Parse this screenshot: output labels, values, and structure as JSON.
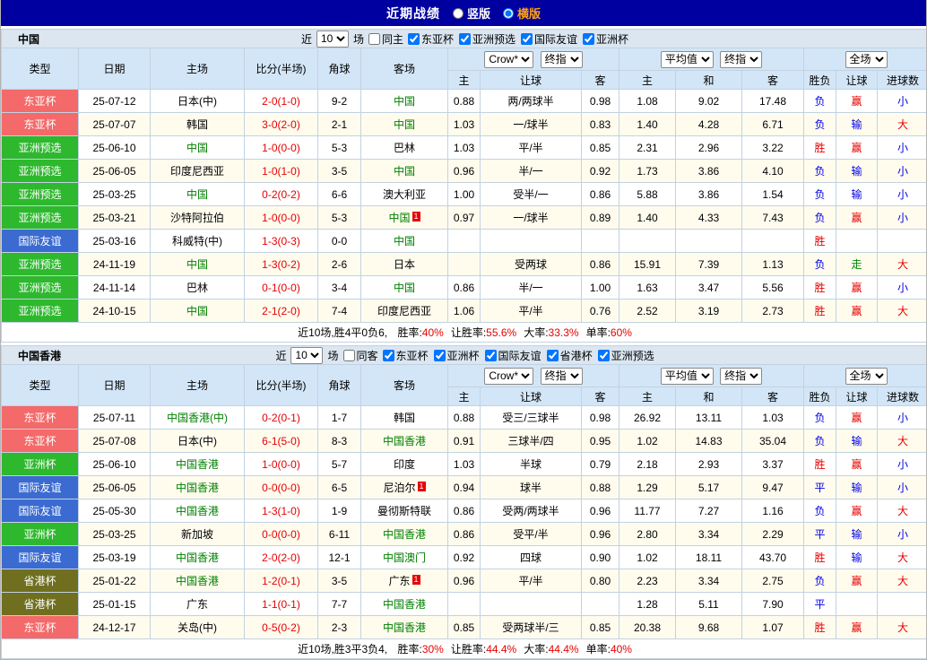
{
  "topbar": {
    "title": "近期战绩",
    "vertical_label": "竖版",
    "horizontal_label": "横版",
    "selected_layout": "横版"
  },
  "filter_ui": {
    "near": "近",
    "matches": "场"
  },
  "dropdowns": {
    "count": "10",
    "asian_company": "Crow*",
    "asian_time": "终指",
    "euro_company": "平均值",
    "euro_time": "终指",
    "scope": "全场"
  },
  "columns": {
    "type": "类型",
    "date": "日期",
    "home": "主场",
    "score": "比分(半场)",
    "corner": "角球",
    "away": "客场",
    "asian_home": "主",
    "asian_handicap": "让球",
    "asian_away": "客",
    "euro_home": "主",
    "euro_draw": "和",
    "euro_away": "客",
    "result": "胜负",
    "handicap_result": "让球",
    "goals": "进球数"
  },
  "colors": {
    "topbar_bg": "#0000a0",
    "highlight_orange": "#ffa216",
    "team_green": "#008000",
    "score_red": "#e60000",
    "type_bg": {
      "东亚杯": "#f46969",
      "亚洲预选": "#2eb82e",
      "亚洲杯": "#2eb82e",
      "国际友谊": "#3b6bd0",
      "省港杯": "#6f6f1f"
    },
    "outcome": {
      "胜": "#e60000",
      "负": "#0000e6",
      "平": "#0000e6",
      "赢": "#e60000",
      "输": "#0000e6",
      "走": "#008800",
      "大": "#e60000",
      "小": "#0000e6"
    }
  },
  "sections": [
    {
      "name": "中国",
      "filter": {
        "same_label": "同主",
        "competitions": [
          "东亚杯",
          "亚洲预选",
          "国际友谊",
          "亚洲杯"
        ]
      },
      "rows": [
        {
          "type": "东亚杯",
          "date": "25-07-12",
          "home": "日本(中)",
          "home_hl": false,
          "home_card": "",
          "score": "2-0(1-0)",
          "corner": "9-2",
          "away": "中国",
          "away_hl": true,
          "away_card": "",
          "asian": [
            "0.88",
            "两/两球半",
            "0.98"
          ],
          "euro": [
            "1.08",
            "9.02",
            "17.48"
          ],
          "outcome": [
            "负",
            "赢",
            "小"
          ]
        },
        {
          "type": "东亚杯",
          "date": "25-07-07",
          "home": "韩国",
          "home_hl": false,
          "home_card": "",
          "score": "3-0(2-0)",
          "corner": "2-1",
          "away": "中国",
          "away_hl": true,
          "away_card": "",
          "asian": [
            "1.03",
            "一/球半",
            "0.83"
          ],
          "euro": [
            "1.40",
            "4.28",
            "6.71"
          ],
          "outcome": [
            "负",
            "输",
            "大"
          ]
        },
        {
          "type": "亚洲预选",
          "date": "25-06-10",
          "home": "中国",
          "home_hl": true,
          "home_card": "",
          "score": "1-0(0-0)",
          "corner": "5-3",
          "away": "巴林",
          "away_hl": false,
          "away_card": "",
          "asian": [
            "1.03",
            "平/半",
            "0.85"
          ],
          "euro": [
            "2.31",
            "2.96",
            "3.22"
          ],
          "outcome": [
            "胜",
            "赢",
            "小"
          ]
        },
        {
          "type": "亚洲预选",
          "date": "25-06-05",
          "home": "印度尼西亚",
          "home_hl": false,
          "home_card": "",
          "score": "1-0(1-0)",
          "corner": "3-5",
          "away": "中国",
          "away_hl": true,
          "away_card": "",
          "asian": [
            "0.96",
            "半/一",
            "0.92"
          ],
          "euro": [
            "1.73",
            "3.86",
            "4.10"
          ],
          "outcome": [
            "负",
            "输",
            "小"
          ]
        },
        {
          "type": "亚洲预选",
          "date": "25-03-25",
          "home": "中国",
          "home_hl": true,
          "home_card": "",
          "score": "0-2(0-2)",
          "corner": "6-6",
          "away": "澳大利亚",
          "away_hl": false,
          "away_card": "",
          "asian": [
            "1.00",
            "受半/一",
            "0.86"
          ],
          "euro": [
            "5.88",
            "3.86",
            "1.54"
          ],
          "outcome": [
            "负",
            "输",
            "小"
          ]
        },
        {
          "type": "亚洲预选",
          "date": "25-03-21",
          "home": "沙特阿拉伯",
          "home_hl": false,
          "home_card": "",
          "score": "1-0(0-0)",
          "corner": "5-3",
          "away": "中国",
          "away_hl": true,
          "away_card": "1",
          "asian": [
            "0.97",
            "一/球半",
            "0.89"
          ],
          "euro": [
            "1.40",
            "4.33",
            "7.43"
          ],
          "outcome": [
            "负",
            "赢",
            "小"
          ]
        },
        {
          "type": "国际友谊",
          "date": "25-03-16",
          "home": "科威特(中)",
          "home_hl": false,
          "home_card": "",
          "score": "1-3(0-3)",
          "corner": "0-0",
          "away": "中国",
          "away_hl": true,
          "away_card": "",
          "asian": [
            "",
            "",
            ""
          ],
          "euro": [
            "",
            "",
            ""
          ],
          "outcome": [
            "胜",
            "",
            ""
          ]
        },
        {
          "type": "亚洲预选",
          "date": "24-11-19",
          "home": "中国",
          "home_hl": true,
          "home_card": "",
          "score": "1-3(0-2)",
          "corner": "2-6",
          "away": "日本",
          "away_hl": false,
          "away_card": "",
          "asian": [
            "",
            "受两球",
            "0.86"
          ],
          "euro": [
            "15.91",
            "7.39",
            "1.13"
          ],
          "outcome": [
            "负",
            "走",
            "大"
          ]
        },
        {
          "type": "亚洲预选",
          "date": "24-11-14",
          "home": "巴林",
          "home_hl": false,
          "home_card": "",
          "score": "0-1(0-0)",
          "corner": "3-4",
          "away": "中国",
          "away_hl": true,
          "away_card": "",
          "asian": [
            "0.86",
            "半/一",
            "1.00"
          ],
          "euro": [
            "1.63",
            "3.47",
            "5.56"
          ],
          "outcome": [
            "胜",
            "赢",
            "小"
          ]
        },
        {
          "type": "亚洲预选",
          "date": "24-10-15",
          "home": "中国",
          "home_hl": true,
          "home_card": "",
          "score": "2-1(2-0)",
          "corner": "7-4",
          "away": "印度尼西亚",
          "away_hl": false,
          "away_card": "",
          "asian": [
            "1.06",
            "平/半",
            "0.76"
          ],
          "euro": [
            "2.52",
            "3.19",
            "2.73"
          ],
          "outcome": [
            "胜",
            "赢",
            "大"
          ]
        }
      ],
      "summary": {
        "prefix": "近10场,胜4平0负6, ",
        "stats": [
          {
            "label": "胜率:",
            "value": "40%"
          },
          {
            "label": "让胜率:",
            "value": "55.6%"
          },
          {
            "label": "大率:",
            "value": "33.3%"
          },
          {
            "label": "单率:",
            "value": "60%"
          }
        ]
      }
    },
    {
      "name": "中国香港",
      "filter": {
        "same_label": "同客",
        "competitions": [
          "东亚杯",
          "亚洲杯",
          "国际友谊",
          "省港杯",
          "亚洲预选"
        ]
      },
      "rows": [
        {
          "type": "东亚杯",
          "date": "25-07-11",
          "home": "中国香港(中)",
          "home_hl": true,
          "home_card": "",
          "score": "0-2(0-1)",
          "corner": "1-7",
          "away": "韩国",
          "away_hl": false,
          "away_card": "",
          "asian": [
            "0.88",
            "受三/三球半",
            "0.98"
          ],
          "euro": [
            "26.92",
            "13.11",
            "1.03"
          ],
          "outcome": [
            "负",
            "赢",
            "小"
          ]
        },
        {
          "type": "东亚杯",
          "date": "25-07-08",
          "home": "日本(中)",
          "home_hl": false,
          "home_card": "",
          "score": "6-1(5-0)",
          "corner": "8-3",
          "away": "中国香港",
          "away_hl": true,
          "away_card": "",
          "asian": [
            "0.91",
            "三球半/四",
            "0.95"
          ],
          "euro": [
            "1.02",
            "14.83",
            "35.04"
          ],
          "outcome": [
            "负",
            "输",
            "大"
          ]
        },
        {
          "type": "亚洲杯",
          "date": "25-06-10",
          "home": "中国香港",
          "home_hl": true,
          "home_card": "",
          "score": "1-0(0-0)",
          "corner": "5-7",
          "away": "印度",
          "away_hl": false,
          "away_card": "",
          "asian": [
            "1.03",
            "半球",
            "0.79"
          ],
          "euro": [
            "2.18",
            "2.93",
            "3.37"
          ],
          "outcome": [
            "胜",
            "赢",
            "小"
          ]
        },
        {
          "type": "国际友谊",
          "date": "25-06-05",
          "home": "中国香港",
          "home_hl": true,
          "home_card": "",
          "score": "0-0(0-0)",
          "corner": "6-5",
          "away": "尼泊尔",
          "away_hl": false,
          "away_card": "1",
          "asian": [
            "0.94",
            "球半",
            "0.88"
          ],
          "euro": [
            "1.29",
            "5.17",
            "9.47"
          ],
          "outcome": [
            "平",
            "输",
            "小"
          ]
        },
        {
          "type": "国际友谊",
          "date": "25-05-30",
          "home": "中国香港",
          "home_hl": true,
          "home_card": "",
          "score": "1-3(1-0)",
          "corner": "1-9",
          "away": "曼彻斯特联",
          "away_hl": false,
          "away_card": "",
          "asian": [
            "0.86",
            "受两/两球半",
            "0.96"
          ],
          "euro": [
            "11.77",
            "7.27",
            "1.16"
          ],
          "outcome": [
            "负",
            "赢",
            "大"
          ]
        },
        {
          "type": "亚洲杯",
          "date": "25-03-25",
          "home": "新加坡",
          "home_hl": false,
          "home_card": "",
          "score": "0-0(0-0)",
          "corner": "6-11",
          "away": "中国香港",
          "away_hl": true,
          "away_card": "",
          "asian": [
            "0.86",
            "受平/半",
            "0.96"
          ],
          "euro": [
            "2.80",
            "3.34",
            "2.29"
          ],
          "outcome": [
            "平",
            "输",
            "小"
          ]
        },
        {
          "type": "国际友谊",
          "date": "25-03-19",
          "home": "中国香港",
          "home_hl": true,
          "home_card": "",
          "score": "2-0(2-0)",
          "corner": "12-1",
          "away": "中国澳门",
          "away_hl": true,
          "away_card": "",
          "asian": [
            "0.92",
            "四球",
            "0.90"
          ],
          "euro": [
            "1.02",
            "18.11",
            "43.70"
          ],
          "outcome": [
            "胜",
            "输",
            "大"
          ]
        },
        {
          "type": "省港杯",
          "date": "25-01-22",
          "home": "中国香港",
          "home_hl": true,
          "home_card": "",
          "score": "1-2(0-1)",
          "corner": "3-5",
          "away": "广东",
          "away_hl": false,
          "away_card": "1",
          "asian": [
            "0.96",
            "平/半",
            "0.80"
          ],
          "euro": [
            "2.23",
            "3.34",
            "2.75"
          ],
          "outcome": [
            "负",
            "赢",
            "大"
          ]
        },
        {
          "type": "省港杯",
          "date": "25-01-15",
          "home": "广东",
          "home_hl": false,
          "home_card": "",
          "score": "1-1(0-1)",
          "corner": "7-7",
          "away": "中国香港",
          "away_hl": true,
          "away_card": "",
          "asian": [
            "",
            "",
            ""
          ],
          "euro": [
            "1.28",
            "5.11",
            "7.90"
          ],
          "outcome": [
            "平",
            "",
            ""
          ]
        },
        {
          "type": "东亚杯",
          "date": "24-12-17",
          "home": "关岛(中)",
          "home_hl": false,
          "home_card": "",
          "score": "0-5(0-2)",
          "corner": "2-3",
          "away": "中国香港",
          "away_hl": true,
          "away_card": "",
          "asian": [
            "0.85",
            "受两球半/三",
            "0.85"
          ],
          "euro": [
            "20.38",
            "9.68",
            "1.07"
          ],
          "outcome": [
            "胜",
            "赢",
            "大"
          ]
        }
      ],
      "summary": {
        "prefix": "近10场,胜3平3负4, ",
        "stats": [
          {
            "label": "胜率:",
            "value": "30%"
          },
          {
            "label": "让胜率:",
            "value": "44.4%"
          },
          {
            "label": "大率:",
            "value": "44.4%"
          },
          {
            "label": "单率:",
            "value": "40%"
          }
        ]
      }
    }
  ]
}
